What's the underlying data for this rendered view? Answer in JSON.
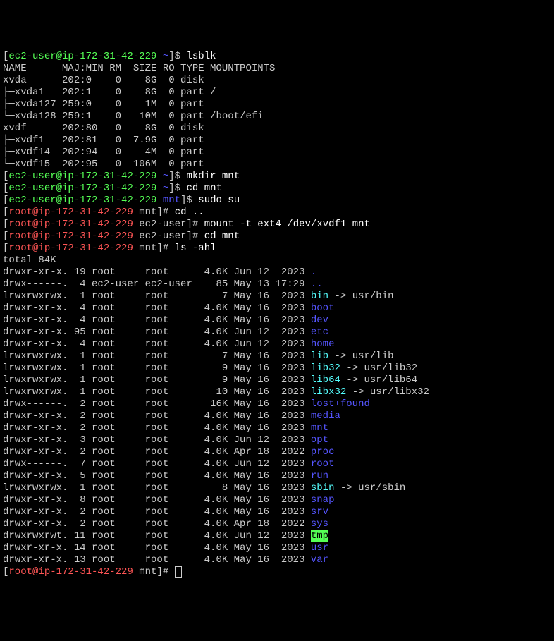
{
  "prompt1": {
    "open": "[",
    "user": "ec2-user",
    "at": "@",
    "host": "ip-172-31-42-229",
    "sp": " ",
    "dir": "~",
    "close": "]$ "
  },
  "cmd1": "lsblk",
  "lsblk_header": "NAME      MAJ:MIN RM  SIZE RO TYPE MOUNTPOINTS",
  "lsblk_rows": [
    "xvda      202:0    0    8G  0 disk ",
    "├─xvda1   202:1    0    8G  0 part /",
    "├─xvda127 259:0    0    1M  0 part ",
    "└─xvda128 259:1    0   10M  0 part /boot/efi",
    "xvdf      202:80   0    8G  0 disk ",
    "├─xvdf1   202:81   0  7.9G  0 part ",
    "├─xvdf14  202:94   0    4M  0 part ",
    "└─xvdf15  202:95   0  106M  0 part "
  ],
  "cmd2": "mkdir mnt",
  "cmd3": "cd mnt",
  "prompt2_dir": "mnt",
  "cmd4": "sudo su",
  "root_prompt": {
    "open": "[",
    "user": "root",
    "at": "@",
    "host": "ip-172-31-42-229",
    "sp": " ",
    "close": "]# "
  },
  "root_dir1": "mnt",
  "cmd5": "cd ..",
  "root_dir2": "ec2-user",
  "cmd6": "mount -t ext4 /dev/xvdf1 mnt",
  "cmd7": "cd mnt",
  "cmd8": "ls -ahl",
  "total": "total 84K",
  "ls": [
    {
      "perm": "drwxr-xr-x.",
      "n": "19",
      "u": "root    ",
      "g": "root    ",
      "sz": " 4.0K",
      "dt": "Jun 12  2023",
      "nm": ".",
      "cls": "blue"
    },
    {
      "perm": "drwx------.",
      "n": " 4",
      "u": "ec2-user",
      "g": "ec2-user",
      "sz": "   85",
      "dt": "May 13 17:29",
      "nm": "..",
      "cls": "blue"
    },
    {
      "perm": "lrwxrwxrwx.",
      "n": " 1",
      "u": "root    ",
      "g": "root    ",
      "sz": "    7",
      "dt": "May 16  2023",
      "nm": "bin",
      "cls": "cyan",
      "lk": " -> usr/bin"
    },
    {
      "perm": "drwxr-xr-x.",
      "n": " 4",
      "u": "root    ",
      "g": "root    ",
      "sz": " 4.0K",
      "dt": "May 16  2023",
      "nm": "boot",
      "cls": "blue"
    },
    {
      "perm": "drwxr-xr-x.",
      "n": " 4",
      "u": "root    ",
      "g": "root    ",
      "sz": " 4.0K",
      "dt": "May 16  2023",
      "nm": "dev",
      "cls": "blue"
    },
    {
      "perm": "drwxr-xr-x.",
      "n": "95",
      "u": "root    ",
      "g": "root    ",
      "sz": " 4.0K",
      "dt": "Jun 12  2023",
      "nm": "etc",
      "cls": "blue"
    },
    {
      "perm": "drwxr-xr-x.",
      "n": " 4",
      "u": "root    ",
      "g": "root    ",
      "sz": " 4.0K",
      "dt": "Jun 12  2023",
      "nm": "home",
      "cls": "blue"
    },
    {
      "perm": "lrwxrwxrwx.",
      "n": " 1",
      "u": "root    ",
      "g": "root    ",
      "sz": "    7",
      "dt": "May 16  2023",
      "nm": "lib",
      "cls": "cyan",
      "lk": " -> usr/lib"
    },
    {
      "perm": "lrwxrwxrwx.",
      "n": " 1",
      "u": "root    ",
      "g": "root    ",
      "sz": "    9",
      "dt": "May 16  2023",
      "nm": "lib32",
      "cls": "cyan",
      "lk": " -> usr/lib32"
    },
    {
      "perm": "lrwxrwxrwx.",
      "n": " 1",
      "u": "root    ",
      "g": "root    ",
      "sz": "    9",
      "dt": "May 16  2023",
      "nm": "lib64",
      "cls": "cyan",
      "lk": " -> usr/lib64"
    },
    {
      "perm": "lrwxrwxrwx.",
      "n": " 1",
      "u": "root    ",
      "g": "root    ",
      "sz": "   10",
      "dt": "May 16  2023",
      "nm": "libx32",
      "cls": "cyan",
      "lk": " -> usr/libx32"
    },
    {
      "perm": "drwx------.",
      "n": " 2",
      "u": "root    ",
      "g": "root    ",
      "sz": "  16K",
      "dt": "May 16  2023",
      "nm": "lost+found",
      "cls": "blue"
    },
    {
      "perm": "drwxr-xr-x.",
      "n": " 2",
      "u": "root    ",
      "g": "root    ",
      "sz": " 4.0K",
      "dt": "May 16  2023",
      "nm": "media",
      "cls": "blue"
    },
    {
      "perm": "drwxr-xr-x.",
      "n": " 2",
      "u": "root    ",
      "g": "root    ",
      "sz": " 4.0K",
      "dt": "May 16  2023",
      "nm": "mnt",
      "cls": "blue"
    },
    {
      "perm": "drwxr-xr-x.",
      "n": " 3",
      "u": "root    ",
      "g": "root    ",
      "sz": " 4.0K",
      "dt": "Jun 12  2023",
      "nm": "opt",
      "cls": "blue"
    },
    {
      "perm": "drwxr-xr-x.",
      "n": " 2",
      "u": "root    ",
      "g": "root    ",
      "sz": " 4.0K",
      "dt": "Apr 18  2022",
      "nm": "proc",
      "cls": "blue"
    },
    {
      "perm": "drwx------.",
      "n": " 7",
      "u": "root    ",
      "g": "root    ",
      "sz": " 4.0K",
      "dt": "Jun 12  2023",
      "nm": "root",
      "cls": "blue"
    },
    {
      "perm": "drwxr-xr-x.",
      "n": " 5",
      "u": "root    ",
      "g": "root    ",
      "sz": " 4.0K",
      "dt": "May 16  2023",
      "nm": "run",
      "cls": "blue"
    },
    {
      "perm": "lrwxrwxrwx.",
      "n": " 1",
      "u": "root    ",
      "g": "root    ",
      "sz": "    8",
      "dt": "May 16  2023",
      "nm": "sbin",
      "cls": "cyan",
      "lk": " -> usr/sbin"
    },
    {
      "perm": "drwxr-xr-x.",
      "n": " 8",
      "u": "root    ",
      "g": "root    ",
      "sz": " 4.0K",
      "dt": "May 16  2023",
      "nm": "snap",
      "cls": "blue"
    },
    {
      "perm": "drwxr-xr-x.",
      "n": " 2",
      "u": "root    ",
      "g": "root    ",
      "sz": " 4.0K",
      "dt": "May 16  2023",
      "nm": "srv",
      "cls": "blue"
    },
    {
      "perm": "drwxr-xr-x.",
      "n": " 2",
      "u": "root    ",
      "g": "root    ",
      "sz": " 4.0K",
      "dt": "Apr 18  2022",
      "nm": "sys",
      "cls": "blue"
    },
    {
      "perm": "drwxrwxrwt.",
      "n": "11",
      "u": "root    ",
      "g": "root    ",
      "sz": " 4.0K",
      "dt": "Jun 12  2023",
      "nm": "tmp",
      "cls": "tmp"
    },
    {
      "perm": "drwxr-xr-x.",
      "n": "14",
      "u": "root    ",
      "g": "root    ",
      "sz": " 4.0K",
      "dt": "May 16  2023",
      "nm": "usr",
      "cls": "blue"
    },
    {
      "perm": "drwxr-xr-x.",
      "n": "13",
      "u": "root    ",
      "g": "root    ",
      "sz": " 4.0K",
      "dt": "May 16  2023",
      "nm": "var",
      "cls": "blue"
    }
  ]
}
